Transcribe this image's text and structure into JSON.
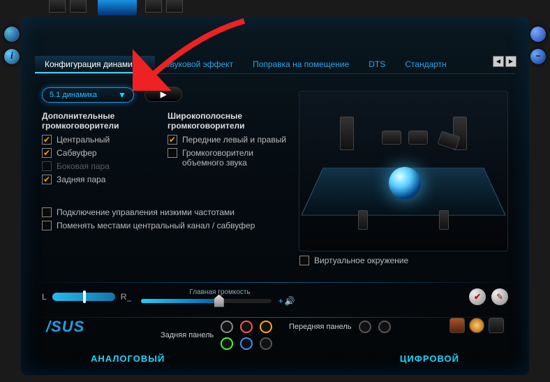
{
  "tabs": {
    "items": [
      "Конфигурация динамиков",
      "Звуковой эффект",
      "Поправка на помещение",
      "DTS",
      "Стандартн"
    ],
    "active": 0
  },
  "dropdown": {
    "value": "5.1 динамика"
  },
  "cols": {
    "left_title": "Дополнительные громкоговорители",
    "right_title": "Широкополосные громкоговорители",
    "left": [
      {
        "label": "Центральный",
        "checked": true,
        "disabled": false
      },
      {
        "label": "Сабвуфер",
        "checked": true,
        "disabled": false
      },
      {
        "label": "Боковая пара",
        "checked": false,
        "disabled": true
      },
      {
        "label": "Задняя пара",
        "checked": true,
        "disabled": false
      }
    ],
    "right": [
      {
        "label": "Передние левый и правый",
        "checked": true
      },
      {
        "label": "Громкоговорители объемного звука",
        "checked": false
      }
    ]
  },
  "below": [
    {
      "label": "Подключение управления низкими частотами",
      "checked": false
    },
    {
      "label": "Поменять местами центральный канал / сабвуфер",
      "checked": false
    }
  ],
  "virtual": {
    "label": "Виртуальное окружение",
    "checked": false
  },
  "volume": {
    "title": "Главная громкость",
    "L": "L",
    "R": "R",
    "plus": "+"
  },
  "footer": {
    "logo": "/SUS",
    "rear": "Задняя панель",
    "front": "Передняя панель",
    "analog": "АНАЛОГОВЫЙ",
    "digital": "ЦИФРОВОЙ"
  },
  "info_glyph": "i",
  "minus_glyph": "−",
  "nav": {
    "prev": "◄",
    "next": "►"
  }
}
